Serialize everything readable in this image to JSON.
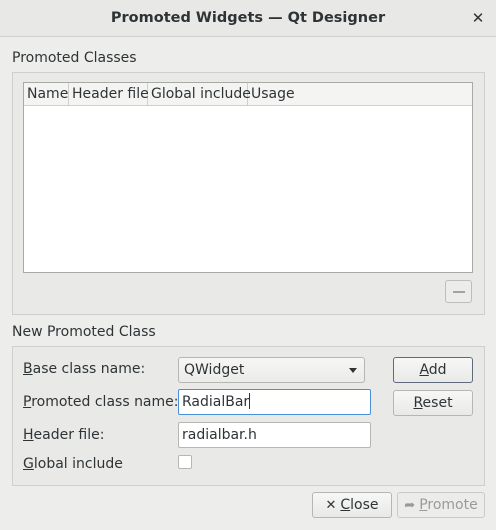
{
  "window": {
    "title": "Promoted Widgets — Qt Designer",
    "close_glyph": "✕"
  },
  "promoted_classes": {
    "section_title": "Promoted Classes",
    "columns": [
      "Name",
      "Header file",
      "Global include",
      "Usage"
    ],
    "rows": [],
    "remove_icon": "minus-icon"
  },
  "new_class": {
    "section_title": "New Promoted Class",
    "base_class_label": {
      "mnemonic": "B",
      "rest": "ase class name:"
    },
    "base_class_value": "QWidget",
    "promoted_label": {
      "mnemonic": "P",
      "rest": "romoted class name:"
    },
    "promoted_value": "RadialBar",
    "header_label": {
      "mnemonic": "H",
      "rest": "eader file:"
    },
    "header_value": "radialbar.h",
    "global_label": {
      "mnemonic": "G",
      "rest": "lobal include"
    },
    "global_checked": false,
    "add_button": {
      "mnemonic": "A",
      "rest": "dd"
    },
    "reset_button": {
      "mnemonic": "R",
      "rest": "eset"
    }
  },
  "footer": {
    "close_button": {
      "icon": "close-icon",
      "icon_glyph": "✕",
      "mnemonic": "C",
      "rest": "lose"
    },
    "promote_button": {
      "icon": "promote-icon",
      "icon_glyph": "➦",
      "mnemonic": "P",
      "rest": "romote",
      "disabled": true
    }
  },
  "colors": {
    "accent_focus": "#4a90d9",
    "background": "#ededec"
  }
}
